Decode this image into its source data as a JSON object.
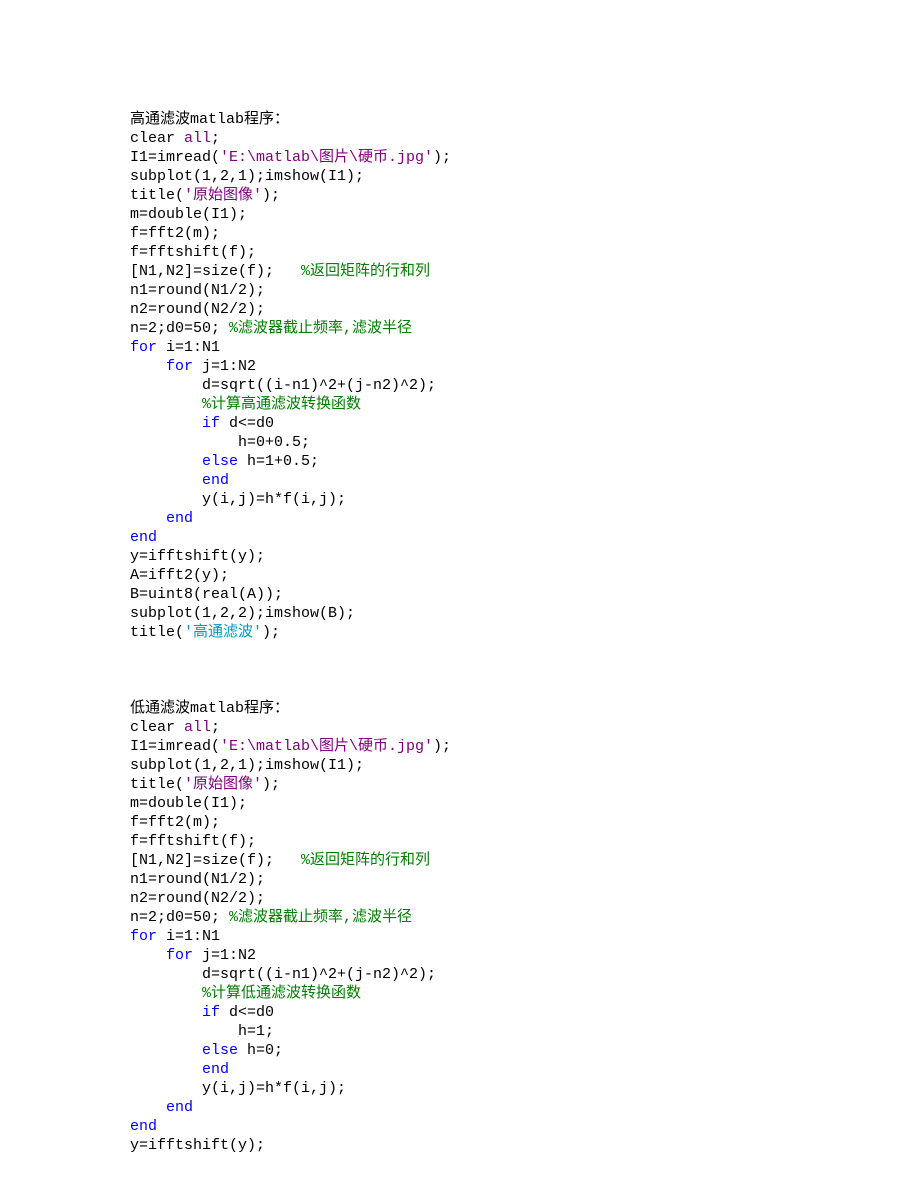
{
  "block1": {
    "heading_prefix": "高通滤波",
    "heading_suffix_pre": "matlab",
    "heading_suffix_post": "程序：",
    "l2a": "clear ",
    "l2b": "all",
    "l2c": ";",
    "l3a": "I1=imread(",
    "l3b": "'E:\\matlab\\图片\\硬币.jpg'",
    "l3c": ");",
    "l4": "subplot(1,2,1);imshow(I1);",
    "l5a": "title(",
    "l5b": "'原始图像'",
    "l5c": ");",
    "l6": "m=double(I1);",
    "l7": "f=fft2(m);",
    "l8": "f=fftshift(f);",
    "l9a": "[N1,N2]=size(f);   ",
    "l9b": "%返回矩阵的行和列",
    "l10": "n1=round(N1/2);",
    "l11": "n2=round(N2/2);",
    "l12a": "n=2;d0=50; ",
    "l12b": "%滤波器截止频率,滤波半径",
    "l13a": "for",
    "l13b": " i=1:N1",
    "l14a": "    ",
    "l14b": "for",
    "l14c": " j=1:N2",
    "l15": "        d=sqrt((i-n1)^2+(j-n2)^2);",
    "l16": "        %计算高通滤波转换函数",
    "l17a": "        ",
    "l17b": "if",
    "l17c": " d<=d0",
    "l18": "            h=0+0.5;",
    "l19a": "        ",
    "l19b": "else",
    "l19c": " h=1+0.5;",
    "l20a": "        ",
    "l20b": "end",
    "l21": "        y(i,j)=h*f(i,j);",
    "l22a": "    ",
    "l22b": "end",
    "l23": "end",
    "l24": "y=ifftshift(y);",
    "l25": "A=ifft2(y);",
    "l26": "B=uint8(real(A));",
    "l27": "subplot(1,2,2);imshow(B);",
    "l28a": "title(",
    "l28b": "'高通滤波'",
    "l28c": ");"
  },
  "block2": {
    "heading_prefix": "低通滤波",
    "heading_suffix_pre": "matlab",
    "heading_suffix_post": "程序：",
    "l2a": "clear ",
    "l2b": "all",
    "l2c": ";",
    "l3a": "I1=imread(",
    "l3b": "'E:\\matlab\\图片\\硬币.jpg'",
    "l3c": ");",
    "l4": "subplot(1,2,1);imshow(I1);",
    "l5a": "title(",
    "l5b": "'原始图像'",
    "l5c": ");",
    "l6": "m=double(I1);",
    "l7": "f=fft2(m);",
    "l8": "f=fftshift(f);",
    "l9a": "[N1,N2]=size(f);   ",
    "l9b": "%返回矩阵的行和列",
    "l10": "n1=round(N1/2);",
    "l11": "n2=round(N2/2);",
    "l12a": "n=2;d0=50; ",
    "l12b": "%滤波器截止频率,滤波半径",
    "l13a": "for",
    "l13b": " i=1:N1",
    "l14a": "    ",
    "l14b": "for",
    "l14c": " j=1:N2",
    "l15": "        d=sqrt((i-n1)^2+(j-n2)^2);",
    "l16": "        %计算低通滤波转换函数",
    "l17a": "        ",
    "l17b": "if",
    "l17c": " d<=d0",
    "l18": "            h=1;",
    "l19a": "        ",
    "l19b": "else",
    "l19c": " h=0;",
    "l20a": "        ",
    "l20b": "end",
    "l21": "        y(i,j)=h*f(i,j);",
    "l22a": "    ",
    "l22b": "end",
    "l23": "end",
    "l24": "y=ifftshift(y);"
  }
}
